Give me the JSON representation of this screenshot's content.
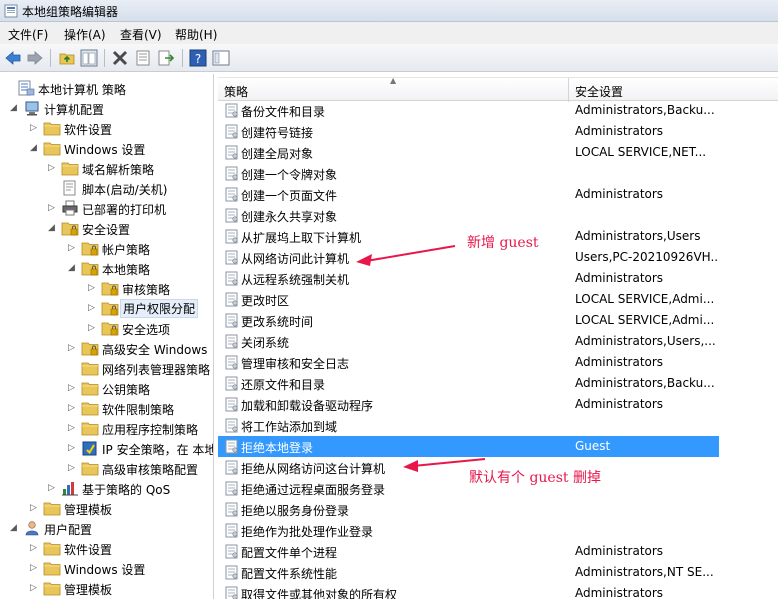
{
  "window": {
    "title": "本地组策略编辑器"
  },
  "menu": [
    "文件(F)",
    "操作(A)",
    "查看(V)",
    "帮助(H)"
  ],
  "toolbar_icons": [
    "back-arrow-icon",
    "forward-arrow-icon",
    "up-folder-icon",
    "show-tree-icon",
    "delete-icon",
    "properties-icon",
    "export-icon",
    "help-icon",
    "extended-view-icon"
  ],
  "tree": [
    {
      "label": "本地计算机 策略",
      "icon": "computer-policy-icon",
      "expander": ""
    },
    {
      "label": "计算机配置",
      "icon": "computer-icon",
      "expander": "expanded"
    },
    {
      "label": "软件设置",
      "icon": "folder-icon",
      "expander": "collapsed"
    },
    {
      "label": "Windows 设置",
      "icon": "folder-icon",
      "expander": "expanded"
    },
    {
      "label": "域名解析策略",
      "icon": "folder-icon",
      "expander": "collapsed"
    },
    {
      "label": "脚本(启动/关机)",
      "icon": "script-icon",
      "expander": ""
    },
    {
      "label": "已部署的打印机",
      "icon": "printer-icon",
      "expander": "collapsed"
    },
    {
      "label": "安全设置",
      "icon": "security-folder-icon",
      "expander": "expanded"
    },
    {
      "label": "帐户策略",
      "icon": "security-folder-icon",
      "expander": "collapsed"
    },
    {
      "label": "本地策略",
      "icon": "security-folder-icon",
      "expander": "expanded"
    },
    {
      "label": "审核策略",
      "icon": "security-folder-icon",
      "expander": "collapsed"
    },
    {
      "label": "用户权限分配",
      "icon": "security-folder-icon",
      "expander": "collapsed",
      "selected": true
    },
    {
      "label": "安全选项",
      "icon": "security-folder-icon",
      "expander": "collapsed"
    },
    {
      "label": "高级安全 Windows",
      "icon": "security-folder-icon",
      "expander": "collapsed"
    },
    {
      "label": "网络列表管理器策略",
      "icon": "folder-icon",
      "expander": ""
    },
    {
      "label": "公钥策略",
      "icon": "folder-icon",
      "expander": "collapsed"
    },
    {
      "label": "软件限制策略",
      "icon": "folder-icon",
      "expander": "collapsed"
    },
    {
      "label": "应用程序控制策略",
      "icon": "folder-icon",
      "expander": "collapsed"
    },
    {
      "label": "IP 安全策略，在 本地",
      "icon": "ip-security-icon",
      "expander": "collapsed"
    },
    {
      "label": "高级审核策略配置",
      "icon": "folder-icon",
      "expander": "collapsed"
    },
    {
      "label": "基于策略的 QoS",
      "icon": "qos-chart-icon",
      "expander": "collapsed"
    },
    {
      "label": "管理模板",
      "icon": "folder-icon",
      "expander": "collapsed"
    },
    {
      "label": "用户配置",
      "icon": "user-icon",
      "expander": "expanded"
    },
    {
      "label": "软件设置",
      "icon": "folder-icon",
      "expander": "collapsed"
    },
    {
      "label": "Windows 设置",
      "icon": "folder-icon",
      "expander": "collapsed"
    },
    {
      "label": "管理模板",
      "icon": "folder-icon",
      "expander": "collapsed"
    }
  ],
  "list": {
    "columns": {
      "policy": "策略",
      "setting": "安全设置"
    },
    "rows": [
      {
        "policy": "备份文件和目录",
        "setting": "Administrators,Backu..."
      },
      {
        "policy": "创建符号链接",
        "setting": "Administrators"
      },
      {
        "policy": "创建全局对象",
        "setting": "LOCAL SERVICE,NET..."
      },
      {
        "policy": "创建一个令牌对象",
        "setting": ""
      },
      {
        "policy": "创建一个页面文件",
        "setting": "Administrators"
      },
      {
        "policy": "创建永久共享对象",
        "setting": ""
      },
      {
        "policy": "从扩展坞上取下计算机",
        "setting": "Administrators,Users"
      },
      {
        "policy": "从网络访问此计算机",
        "setting": "Users,PC-20210926VH..."
      },
      {
        "policy": "从远程系统强制关机",
        "setting": "Administrators"
      },
      {
        "policy": "更改时区",
        "setting": "LOCAL SERVICE,Admi..."
      },
      {
        "policy": "更改系统时间",
        "setting": "LOCAL SERVICE,Admi..."
      },
      {
        "policy": "关闭系统",
        "setting": "Administrators,Users,..."
      },
      {
        "policy": "管理审核和安全日志",
        "setting": "Administrators"
      },
      {
        "policy": "还原文件和目录",
        "setting": "Administrators,Backu..."
      },
      {
        "policy": "加载和卸载设备驱动程序",
        "setting": "Administrators"
      },
      {
        "policy": "将工作站添加到域",
        "setting": ""
      },
      {
        "policy": "拒绝本地登录",
        "setting": "Guest",
        "selected": true
      },
      {
        "policy": "拒绝从网络访问这台计算机",
        "setting": ""
      },
      {
        "policy": "拒绝通过远程桌面服务登录",
        "setting": ""
      },
      {
        "policy": "拒绝以服务身份登录",
        "setting": ""
      },
      {
        "policy": "拒绝作为批处理作业登录",
        "setting": ""
      },
      {
        "policy": "配置文件单个进程",
        "setting": "Administrators"
      },
      {
        "policy": "配置文件系统性能",
        "setting": "Administrators,NT SE..."
      },
      {
        "policy": "取得文件或其他对象的所有权",
        "setting": "Administrators"
      }
    ]
  },
  "annotations": {
    "note1": "新增 guest",
    "note2": "默认有个 guest 删掉",
    "color": "#e8174b"
  },
  "colors": {
    "selection": "#3399ff",
    "folder": "#e8c65a"
  }
}
